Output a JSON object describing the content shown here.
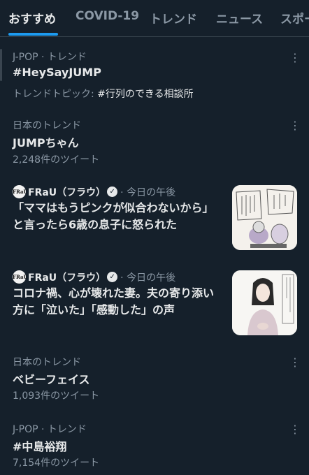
{
  "tabs": [
    {
      "label": "おすすめ"
    },
    {
      "label": "COVID-19"
    },
    {
      "label": "トレンド"
    },
    {
      "label": "ニュース"
    },
    {
      "label": "スポー"
    }
  ],
  "trends": [
    {
      "meta": "J-POP · トレンド",
      "title": "#HeySayJUMP",
      "sub_prefix": "トレンドトピック: ",
      "sub_highlight": "#行列のできる相談所"
    },
    {
      "meta": "日本のトレンド",
      "title": "JUMPちゃん",
      "sub": "2,248件のツイート"
    },
    {
      "meta": "日本のトレンド",
      "title": "ベビーフェイス",
      "sub": "1,093件のツイート"
    },
    {
      "meta": "J-POP · トレンド",
      "title": "#中島裕翔",
      "sub": "7,154件のツイート"
    }
  ],
  "news": [
    {
      "logo_text": "FRaU",
      "source": "FRaU（フラウ）",
      "time": "· 今日の午後",
      "headline": "「ママはもうピンクが似合わないから」と言ったら6歳の息子に怒られた",
      "thumb_icon": "manga-panel-thumbnail"
    },
    {
      "logo_text": "FRaU",
      "source": "FRaU（フラウ）",
      "time": "· 今日の午後",
      "headline": "コロナ禍、心が壊れた妻。夫の寄り添い方に「泣いた」「感動した」の声",
      "thumb_icon": "illustration-woman-thumbnail"
    }
  ],
  "more_icon": "⋮",
  "verified_mark": "✓",
  "colors": {
    "background": "#15202b",
    "accent": "#1d9bf0",
    "text": "#e7e9ea",
    "muted": "#8b98a5"
  }
}
